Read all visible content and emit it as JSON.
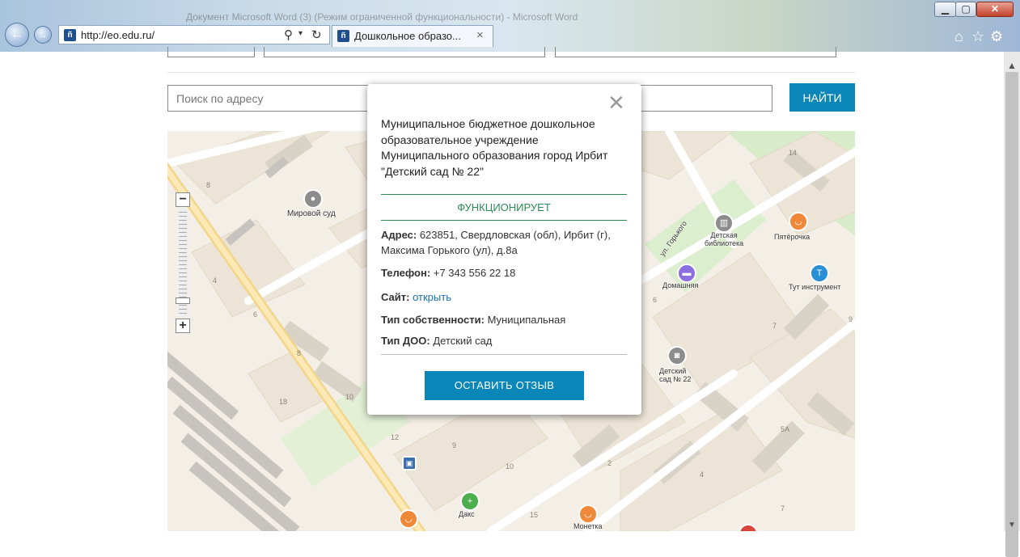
{
  "browser": {
    "window_title": "Документ Microsoft Word (3) (Режим ограниченной функциональности) - Microsoft Word",
    "url": "http://eo.edu.ru/",
    "tab_title": "Дошкольное образо...",
    "close_glyph": "×",
    "icons": [
      "back-icon",
      "forward-icon",
      "search-icon",
      "refresh-icon",
      "home-icon",
      "star-icon",
      "gear-icon"
    ]
  },
  "search": {
    "placeholder": "Поиск по адресу",
    "button_label": "НАЙТИ"
  },
  "map": {
    "zoom_in": "+",
    "zoom_out": "−",
    "labels": {
      "court": "Мировой суд",
      "street": "ул. Горького",
      "library": "Детская\nбиблиотека",
      "pyaterochka": "Пятёрочка",
      "domashnyaya": "Домашняя",
      "tools": "Тут инструмент",
      "kindergarten": "Детский\nсад № 22",
      "daks": "Дакс",
      "monetka": "Монетка"
    },
    "house_numbers": [
      "8",
      "4",
      "6",
      "8",
      "18",
      "10",
      "12",
      "9",
      "10",
      "2",
      "14",
      "6",
      "7",
      "9",
      "5А",
      "4",
      "7",
      "15"
    ]
  },
  "popup": {
    "close_glyph": "✕",
    "title": "Муниципальное бюджетное дошкольное образовательное учреждение Муниципального образования город Ирбит \"Детский сад № 22\"",
    "status": "ФУНКЦИОНИРУЕТ",
    "address_label": "Адрес:",
    "address_value": " 623851, Свердловская (обл), Ирбит (г), Максима Горького (ул), д.8а",
    "phone_label": "Телефон:",
    "phone_value": " +7 343 556 22 18",
    "site_label": "Сайт:",
    "site_link": "открыть",
    "ownership_label": "Тип собственности:",
    "ownership_value": " Муниципальная",
    "type_label": "Тип ДОО:",
    "type_value": " Детский сад",
    "review_button": "ОСТАВИТЬ ОТЗЫВ"
  }
}
